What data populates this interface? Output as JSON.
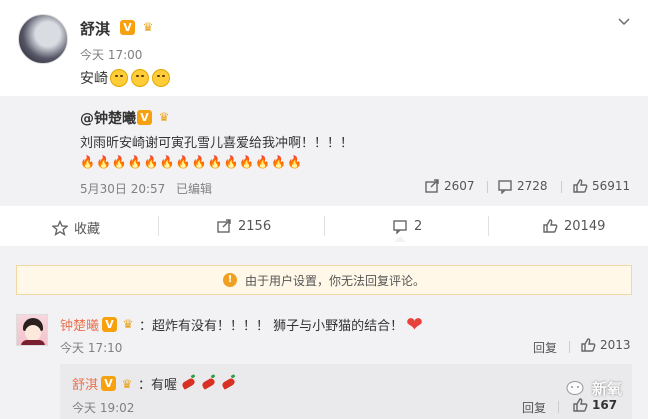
{
  "post": {
    "author": "舒淇",
    "time": "今天 17:00",
    "text": "安崎",
    "menu_icon": "chevron-down-icon"
  },
  "repost": {
    "author": "@钟楚曦",
    "text": "刘雨昕安崎谢可寅孔雪儿喜爱给我冲啊！！！！",
    "time": "5月30日 20:57",
    "edited": "已编辑",
    "share_count": "2607",
    "comment_count": "2728",
    "like_count": "56911"
  },
  "actions": {
    "favorite": "收藏",
    "share": "2156",
    "comment": "2",
    "like": "20149"
  },
  "notice": "由于用户设置，你无法回复评论。",
  "comments": [
    {
      "author": "钟楚曦",
      "text": "：超炸有没有！！！！ 狮子与小野猫的结合！",
      "time": "今天 17:10",
      "reply": "回复",
      "likes": "2013"
    },
    {
      "author": "舒淇",
      "text": "：有喔",
      "time": "今天 19:02",
      "reply": "回复",
      "likes": "167"
    }
  ],
  "watermark": "新氧",
  "colors": {
    "accent": "#eb7350",
    "link": "#eb7350",
    "notice_bg": "#fff8e8",
    "repost_bg": "#f2f2f5"
  }
}
